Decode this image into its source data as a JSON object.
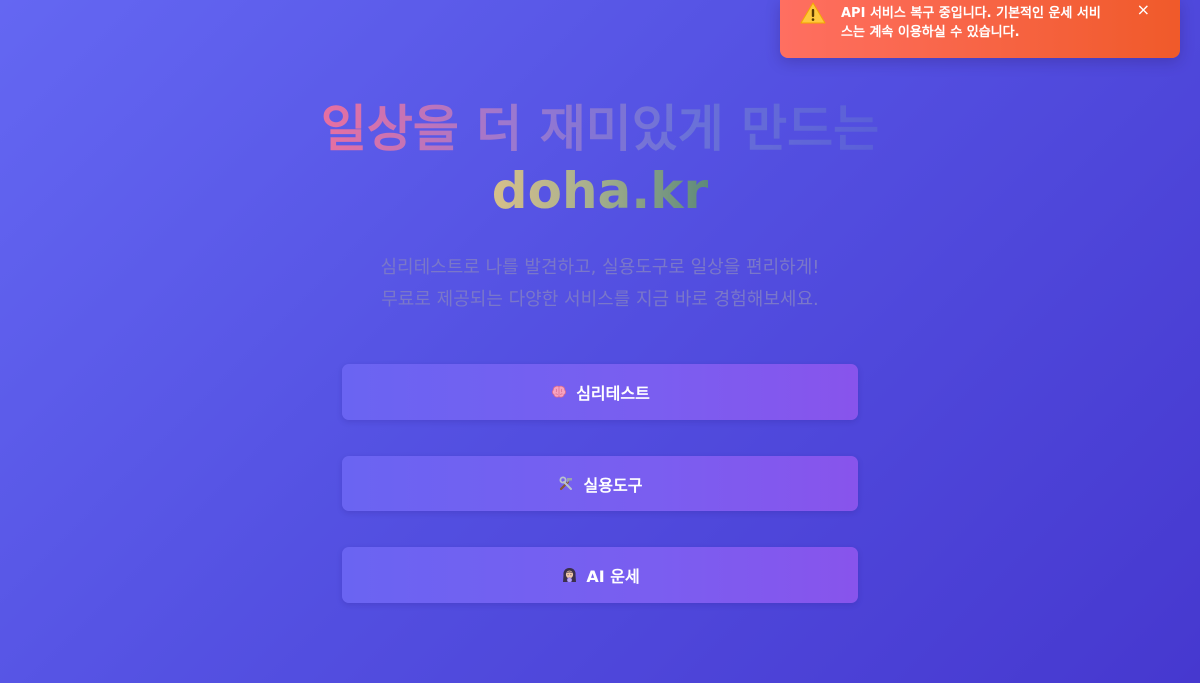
{
  "toast": {
    "icon": "warning-icon",
    "message": "API 서비스 복구 중입니다. 기본적인 운세 서비스는 계속 이용하실 수 있습니다.",
    "close_label": "×",
    "colors": {
      "start": "#ff6f61",
      "end": "#f05a2a"
    }
  },
  "hero": {
    "title_line1": "일상을 더 재미있게 만드는",
    "title_line2": "doha.kr",
    "subtitle_line1": "심리테스트로 나를 발견하고, 실용도구로 일상을 편리하게!",
    "subtitle_line2": "무료로 제공되는 다양한 서비스를 지금 바로 경험해보세요."
  },
  "menu": {
    "items": [
      {
        "label": "심리테스트",
        "icon": "brain-icon"
      },
      {
        "label": "실용도구",
        "icon": "tools-icon"
      },
      {
        "label": "AI 운세",
        "icon": "fortune-teller-icon"
      }
    ]
  },
  "colors": {
    "background_start": "#6467f2",
    "background_end": "#4638cf",
    "button_start": "#6a64f2",
    "button_end": "#8854ec"
  }
}
